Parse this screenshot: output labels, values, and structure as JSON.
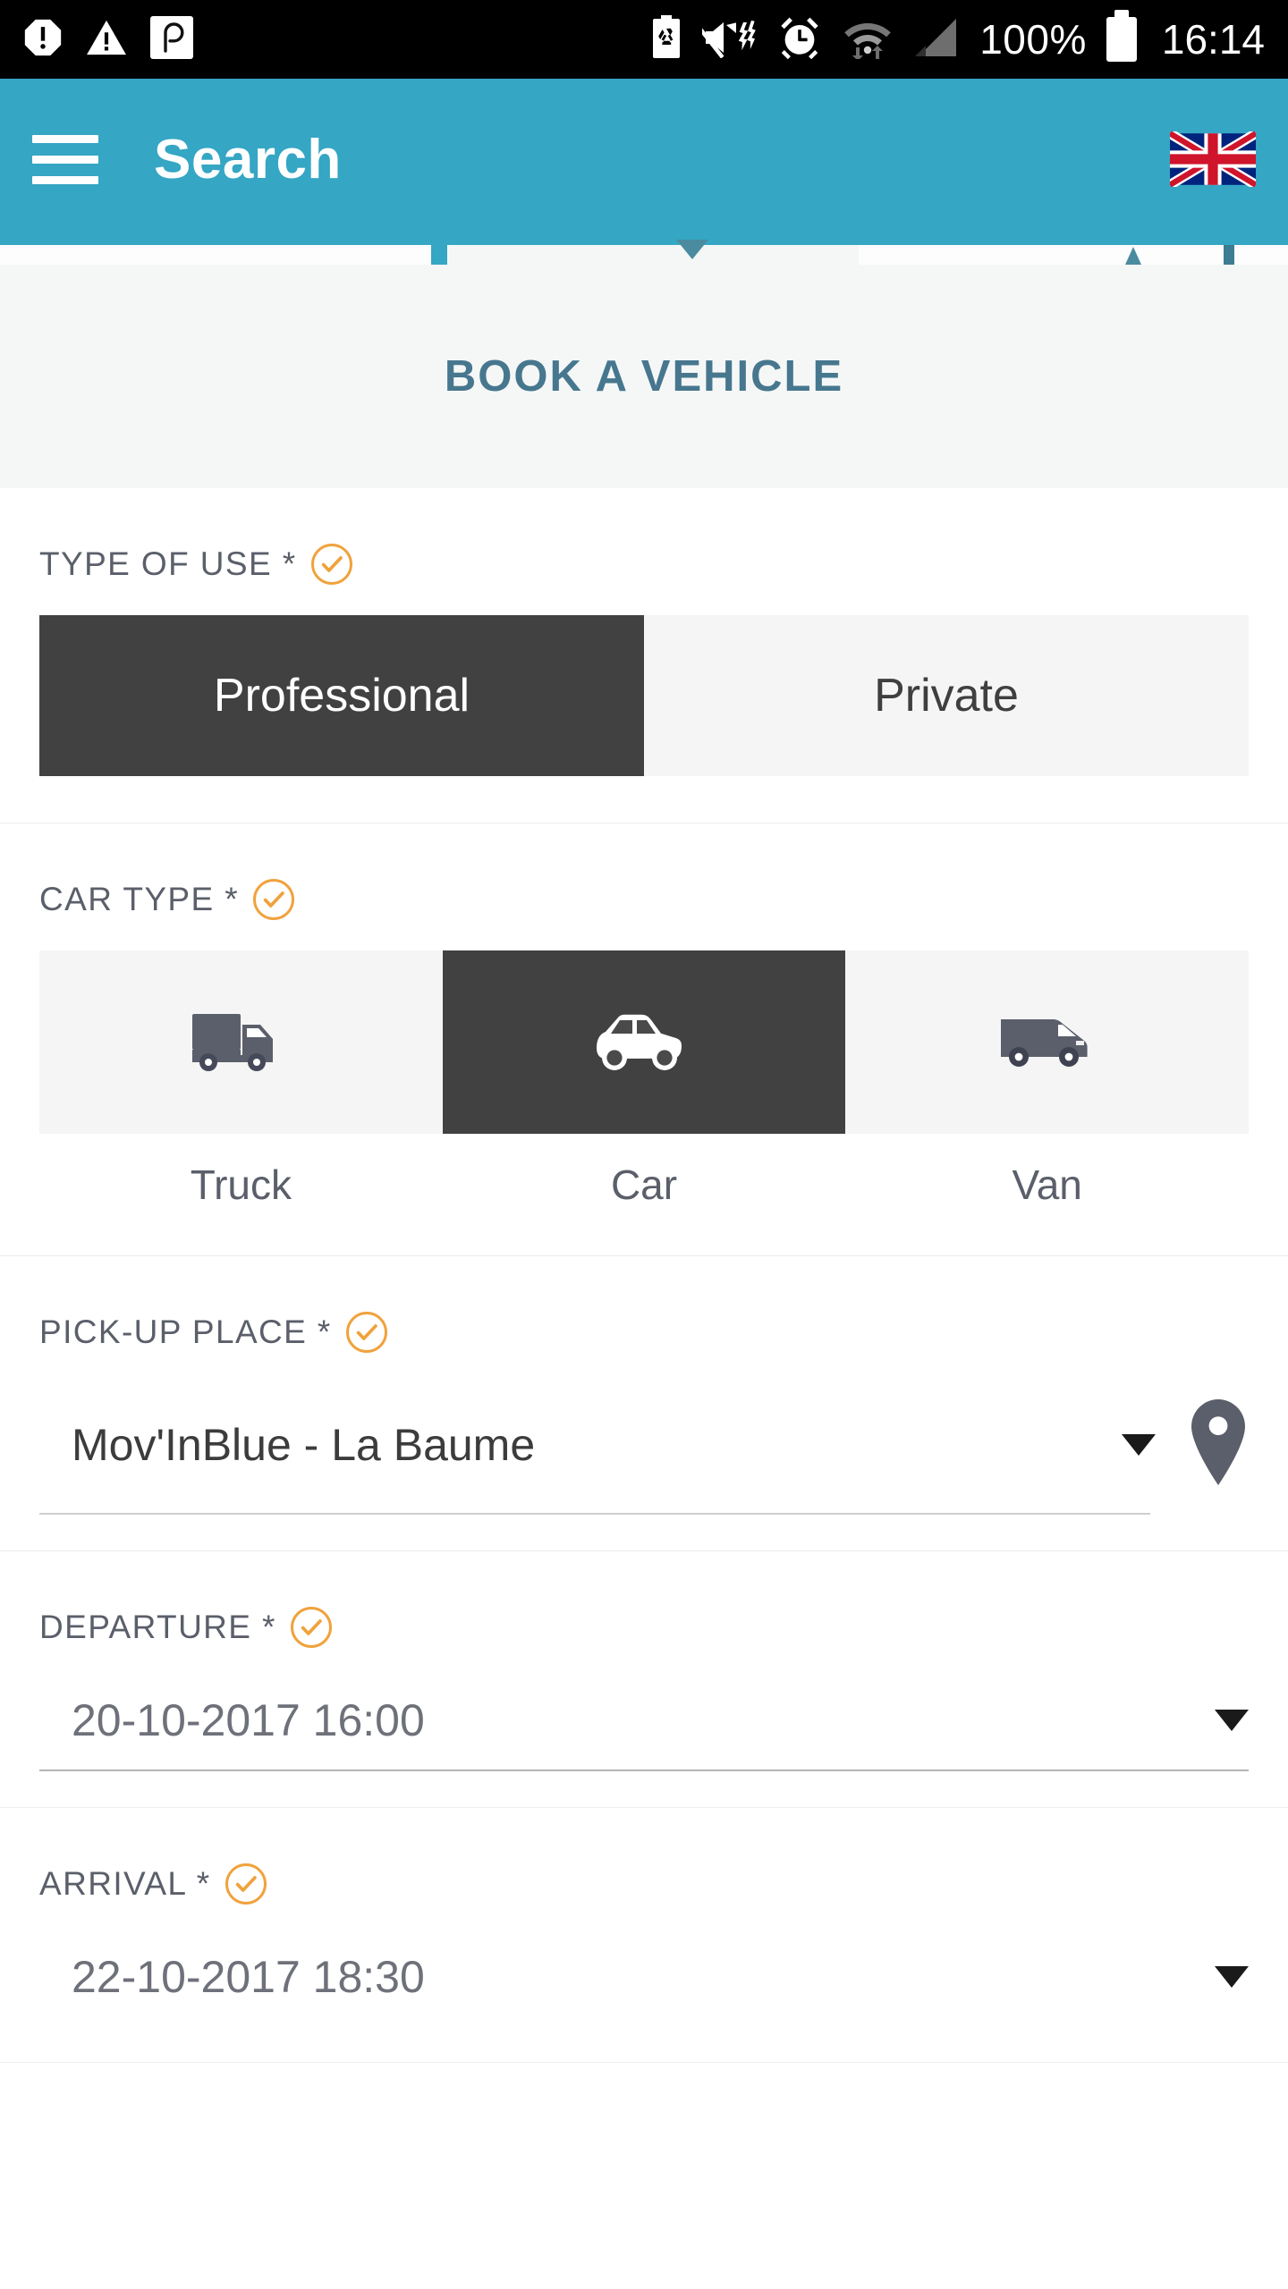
{
  "status_bar": {
    "icons_left": [
      "alert-octagon-icon",
      "warning-triangle-icon",
      "app-p-icon"
    ],
    "icons_right": [
      "battery-saver-icon",
      "mute-vibrate-icon",
      "alarm-clock-icon",
      "wifi-icon",
      "cell-signal-icon"
    ],
    "battery_percent": "100%",
    "time": "16:14"
  },
  "app_bar": {
    "menu_icon": "hamburger-menu-icon",
    "title": "Search",
    "language_flag": "uk-flag-icon",
    "background": "#35A6C4"
  },
  "page": {
    "title": "BOOK A VEHICLE",
    "title_color": "#47778E",
    "accent_color": "#F0A23C",
    "selected_color": "#414141"
  },
  "form": {
    "type_of_use": {
      "label": "TYPE OF USE *",
      "valid_icon": "check-circle-icon",
      "options": [
        "Professional",
        "Private"
      ],
      "selected": "Professional"
    },
    "car_type": {
      "label": "CAR TYPE *",
      "valid_icon": "check-circle-icon",
      "options": [
        {
          "label": "Truck",
          "icon": "truck-icon"
        },
        {
          "label": "Car",
          "icon": "car-icon"
        },
        {
          "label": "Van",
          "icon": "van-icon"
        }
      ],
      "selected": "Car"
    },
    "pickup_place": {
      "label": "PICK-UP PLACE *",
      "valid_icon": "check-circle-icon",
      "value": "Mov'InBlue - La Baume",
      "dropdown_icon": "caret-down-icon",
      "map_icon": "map-pin-icon"
    },
    "departure": {
      "label": "DEPARTURE *",
      "valid_icon": "check-circle-icon",
      "value": "20-10-2017 16:00",
      "dropdown_icon": "caret-down-icon"
    },
    "arrival": {
      "label": "ARRIVAL *",
      "valid_icon": "check-circle-icon",
      "value": "22-10-2017 18:30",
      "dropdown_icon": "caret-down-icon"
    }
  }
}
